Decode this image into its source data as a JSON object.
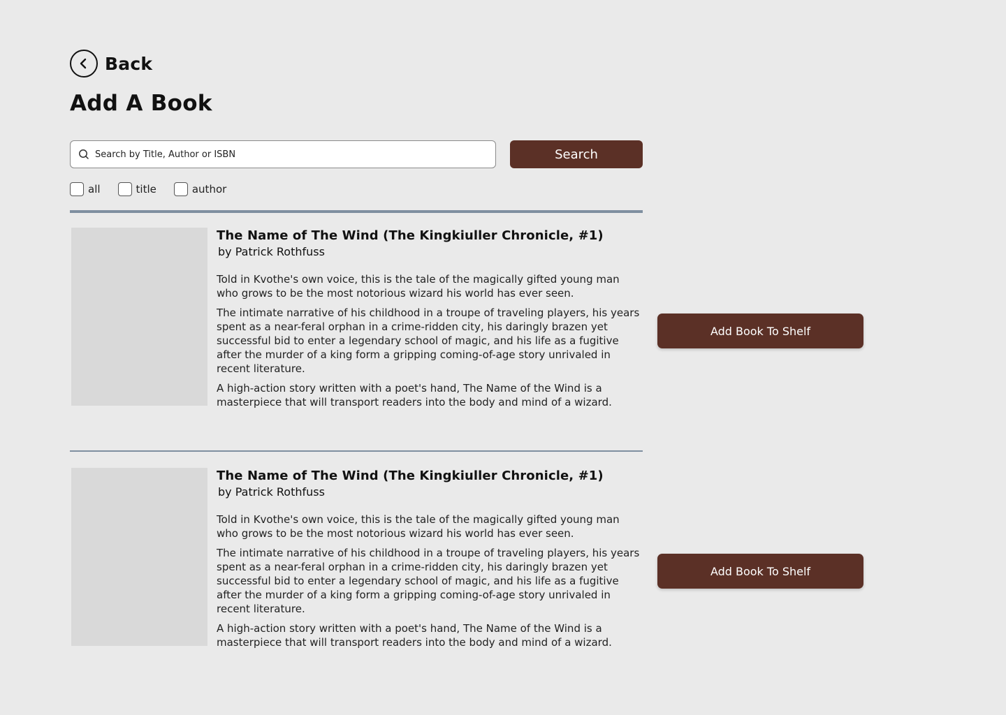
{
  "nav": {
    "back_label": "Back"
  },
  "page": {
    "title": "Add A Book"
  },
  "search": {
    "placeholder": "Search by Title, Author or ISBN",
    "button_label": "Search"
  },
  "filters": [
    {
      "label": "all",
      "checked": false
    },
    {
      "label": "title",
      "checked": false
    },
    {
      "label": "author",
      "checked": false
    }
  ],
  "results": [
    {
      "title": "The Name of The Wind (The Kingkiuller Chronicle, #1)",
      "author": "by Patrick Rothfuss",
      "description": [
        "Told in Kvothe's own voice, this is the tale of the magically gifted young man who grows to be the most notorious wizard his world has ever seen.",
        "The intimate narrative of his childhood in a troupe of traveling players, his years spent as a near-feral orphan in a crime-ridden city, his daringly brazen yet successful bid to enter a legendary school of magic, and his life as a fugitive after the murder of a king form a gripping coming-of-age story unrivaled in recent literature.",
        "A high-action story written with a poet's hand, The Name of the Wind is a masterpiece that will transport readers into the body and mind of a wizard."
      ],
      "button_label": "Add Book To Shelf"
    },
    {
      "title": "The Name of The Wind (The Kingkiuller Chronicle, #1)",
      "author": "by Patrick Rothfuss",
      "description": [
        "Told in Kvothe's own voice, this is the tale of the magically gifted young man who grows to be the most notorious wizard his world has ever seen.",
        "The intimate narrative of his childhood in a troupe of traveling players, his years spent as a near-feral orphan in a crime-ridden city, his daringly brazen yet successful bid to enter a legendary school of magic, and his life as a fugitive after the murder of a king form a gripping coming-of-age story unrivaled in recent literature.",
        "A high-action story written with a poet's hand, The Name of the Wind is a masterpiece that will transport readers into the body and mind of a wizard."
      ],
      "button_label": "Add Book To Shelf"
    }
  ],
  "colors": {
    "background": "#EAEAEA",
    "accent": "#5B3026",
    "divider": "#7F8FA0",
    "cover_placeholder": "#D9D9D9"
  },
  "icons": {
    "back": "chevron-left-circle-icon",
    "search": "search-icon"
  }
}
